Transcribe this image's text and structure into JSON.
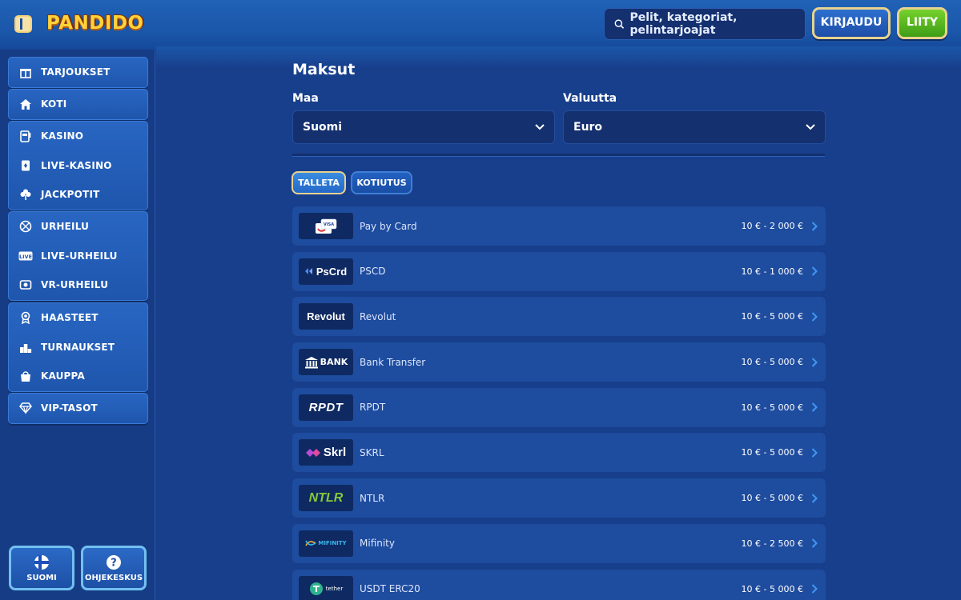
{
  "header": {
    "logo_text": "PANDIDO",
    "search_placeholder": "Pelit, kategoriat, pelintarjoajat",
    "login_label": "KIRJAUDU",
    "join_label": "LIITY"
  },
  "sidebar": {
    "groups": [
      {
        "items": [
          {
            "label": "TARJOUKSET",
            "icon": "gift-icon"
          }
        ]
      },
      {
        "items": [
          {
            "label": "KOTI",
            "icon": "home-icon"
          }
        ]
      },
      {
        "items": [
          {
            "label": "KASINO",
            "icon": "slot-machine-icon"
          },
          {
            "label": "LIVE-KASINO",
            "icon": "playing-card-icon"
          },
          {
            "label": "JACKPOTIT",
            "icon": "clover-icon"
          }
        ]
      },
      {
        "items": [
          {
            "label": "URHEILU",
            "icon": "basketball-icon"
          },
          {
            "label": "LIVE-URHEILU",
            "icon": "live-badge-icon"
          },
          {
            "label": "VR-URHEILU",
            "icon": "vr-soccer-icon"
          }
        ]
      },
      {
        "items": [
          {
            "label": "HAASTEET",
            "icon": "medal-icon"
          },
          {
            "label": "TURNAUKSET",
            "icon": "podium-icon"
          },
          {
            "label": "KAUPPA",
            "icon": "shopping-bag-icon"
          }
        ]
      },
      {
        "items": [
          {
            "label": "VIP-TASOT",
            "icon": "diamond-icon"
          }
        ]
      }
    ],
    "language_label": "SUOMI",
    "help_label": "OHJEKESKUS"
  },
  "main": {
    "title": "Maksut",
    "country_label": "Maa",
    "country_value": "Suomi",
    "currency_label": "Valuutta",
    "currency_value": "Euro",
    "tabs": [
      {
        "label": "TALLETA",
        "active": true
      },
      {
        "label": "KOTIUTUS",
        "active": false
      }
    ],
    "methods": [
      {
        "name": "Pay by Card",
        "range": "10 € - 2 000 €",
        "logo": "card-logo",
        "logo_text": "VISA"
      },
      {
        "name": "PSCD",
        "range": "10 € - 1 000 €",
        "logo": "pscrd-logo",
        "logo_text": "PsCrd"
      },
      {
        "name": "Revolut",
        "range": "10 € - 5 000 €",
        "logo": "revolut-logo",
        "logo_text": "Revolut"
      },
      {
        "name": "Bank Transfer",
        "range": "10 € - 5 000 €",
        "logo": "bank-logo",
        "logo_text": "BANK"
      },
      {
        "name": "RPDT",
        "range": "10 € - 5 000 €",
        "logo": "rpdt-logo",
        "logo_text": "RPDT"
      },
      {
        "name": "SKRL",
        "range": "10 € - 5 000 €",
        "logo": "skrl-logo",
        "logo_text": "Skrl"
      },
      {
        "name": "NTLR",
        "range": "10 € - 5 000 €",
        "logo": "ntlr-logo",
        "logo_text": "NTLR"
      },
      {
        "name": "Mifinity",
        "range": "10 € - 2 500 €",
        "logo": "mifinity-logo",
        "logo_text": "MIFINITY"
      },
      {
        "name": "USDT ERC20",
        "range": "10 € - 5 000 €",
        "logo": "tether-logo",
        "logo_text": "tether"
      }
    ]
  },
  "colors": {
    "background": "#183f8c",
    "header": "#1a55a8",
    "accent_gold": "#e9d28e",
    "join_green": "#4fb01d",
    "row_bg": "#1e4c9e",
    "arrow": "#3f95f0"
  }
}
